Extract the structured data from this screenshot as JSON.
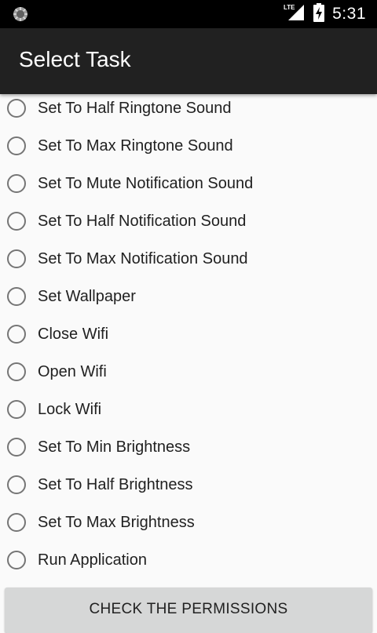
{
  "status_bar": {
    "time": "5:31",
    "network": "LTE",
    "icons": [
      "notification-spinner-icon",
      "lte-signal-icon",
      "battery-charging-icon"
    ]
  },
  "app_bar": {
    "title": "Select Task"
  },
  "tasks": [
    {
      "label": "Set To Half Ringtone Sound",
      "selected": false
    },
    {
      "label": "Set To Max Ringtone Sound",
      "selected": false
    },
    {
      "label": "Set To Mute Notification Sound",
      "selected": false
    },
    {
      "label": "Set To Half Notification Sound",
      "selected": false
    },
    {
      "label": "Set To Max Notification Sound",
      "selected": false
    },
    {
      "label": "Set Wallpaper",
      "selected": false
    },
    {
      "label": "Close Wifi",
      "selected": false
    },
    {
      "label": "Open Wifi",
      "selected": false
    },
    {
      "label": "Lock Wifi",
      "selected": false
    },
    {
      "label": "Set To Min Brightness",
      "selected": false
    },
    {
      "label": "Set To Half Brightness",
      "selected": false
    },
    {
      "label": "Set To Max Brightness",
      "selected": false
    },
    {
      "label": "Run Application",
      "selected": false
    }
  ],
  "actions": {
    "check_permissions": "CHECK THE PERMISSIONS"
  },
  "colors": {
    "status_bar": "#000000",
    "app_bar": "#212121",
    "background": "#fafafa",
    "radio_border": "#757575",
    "button_bg": "#d6d7d7"
  }
}
